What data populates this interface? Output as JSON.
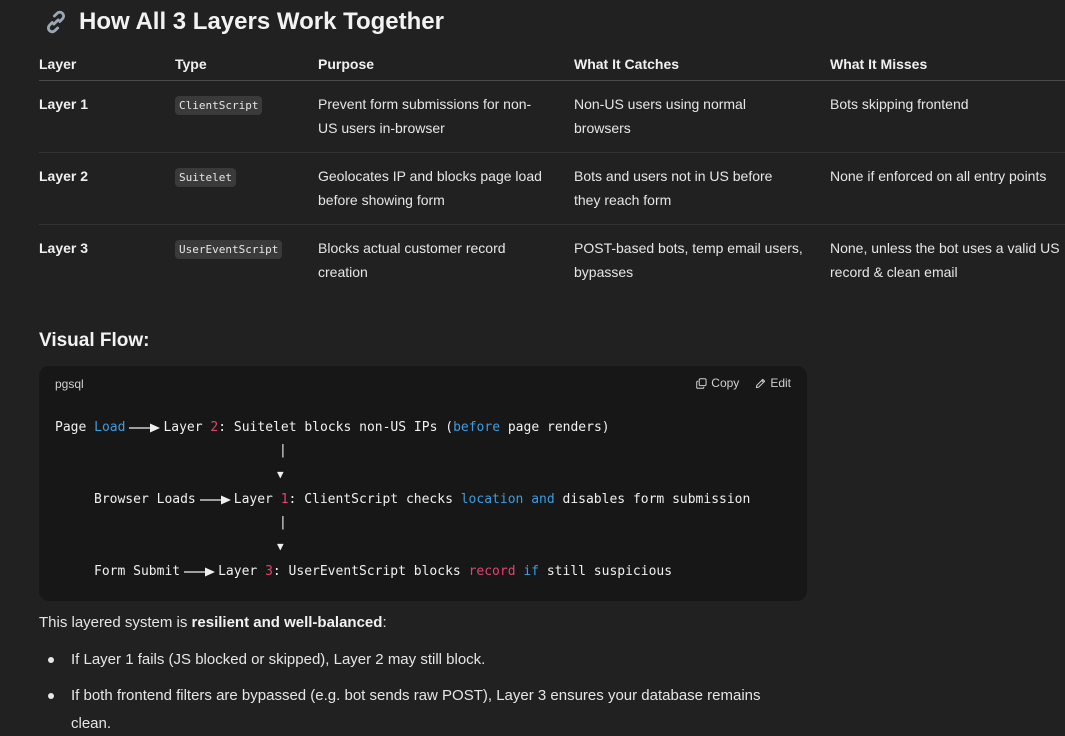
{
  "heading": {
    "title": "How All 3 Layers Work Together",
    "icon": "link-icon"
  },
  "table": {
    "headers": [
      "Layer",
      "Type",
      "Purpose",
      "What It Catches",
      "What It Misses"
    ],
    "rows": [
      {
        "layer": "Layer 1",
        "type": "ClientScript",
        "purpose": "Prevent form submissions for non-US users in-browser",
        "catches": "Non-US users using normal browsers",
        "misses": "Bots skipping frontend"
      },
      {
        "layer": "Layer 2",
        "type": "Suitelet",
        "purpose": "Geolocates IP and blocks page load before showing form",
        "catches": "Bots and users not in US before they reach form",
        "misses": "None if enforced on all entry points"
      },
      {
        "layer": "Layer 3",
        "type": "UserEventScript",
        "purpose": "Blocks actual customer record creation",
        "catches": "POST-based bots, temp email users, bypasses",
        "misses": "None, unless the bot uses a valid US record & clean email"
      }
    ]
  },
  "flow": {
    "heading": "Visual Flow:",
    "language": "pgsql",
    "copy_label": "Copy",
    "edit_label": "Edit",
    "line1": {
      "a": "Page ",
      "kw1": "Load",
      "b": "Layer ",
      "num": "2",
      "c": ": Suitelet blocks non-US IPs (",
      "kw2": "before",
      "d": " page renders)"
    },
    "pipe": "|",
    "down_arrow": "▼",
    "line2": {
      "a": "Browser Loads",
      "b": "Layer ",
      "num": "1",
      "c": ": ClientScript checks ",
      "kw1": "location",
      "d": " ",
      "kw2": "and",
      "e": " disables form submission"
    },
    "line3": {
      "a": "Form Submit",
      "b": "Layer ",
      "num": "3",
      "c": ": UserEventScript blocks ",
      "kw1": "record",
      "d": " ",
      "kw2": "if",
      "e": " still suspicious"
    }
  },
  "summary": {
    "intro_prefix": "This layered system is ",
    "intro_bold": "resilient and well-balanced",
    "intro_suffix": ":",
    "bullets": [
      "If Layer 1 fails (JS blocked or skipped), Layer 2 may still block.",
      "If both frontend filters are bypassed (e.g. bot sends raw POST), Layer 3 ensures your database remains clean."
    ]
  },
  "colors": {
    "background": "#212121",
    "code_background": "#171717",
    "keyword": "#3d9be0",
    "number": "#e0446d"
  }
}
